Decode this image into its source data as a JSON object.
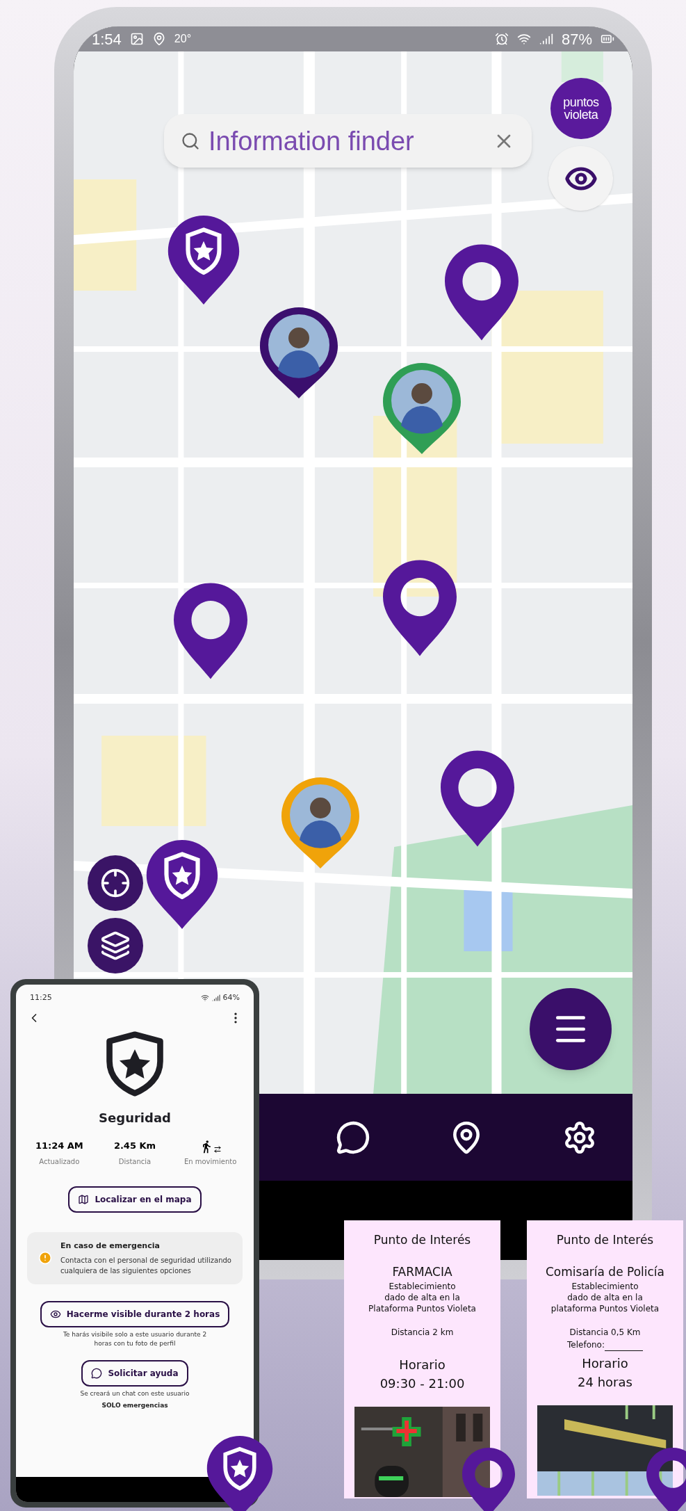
{
  "main_phone": {
    "status_bar": {
      "time": "1:54",
      "temperature": "20°",
      "battery": "87%"
    },
    "logo": [
      "puntos",
      "violeta"
    ],
    "search": {
      "overlay_title": "Information finder"
    },
    "markers": [
      {
        "kind": "police"
      },
      {
        "kind": "pin"
      },
      {
        "kind": "avatar",
        "color": "#3b0f6e"
      },
      {
        "kind": "avatar",
        "color": "#2f9e55"
      },
      {
        "kind": "pin"
      },
      {
        "kind": "pin"
      },
      {
        "kind": "avatar",
        "color": "#f0a30a"
      },
      {
        "kind": "pin"
      },
      {
        "kind": "police"
      }
    ],
    "nav": [
      {
        "kind": "chat"
      },
      {
        "kind": "poi"
      },
      {
        "kind": "settings"
      }
    ]
  },
  "detail_phone": {
    "status_bar": {
      "time": "11:25",
      "battery": "64%"
    },
    "title": "Seguridad",
    "stats": [
      {
        "kind": "text",
        "value": "11:24 AM",
        "label": "Actualizado"
      },
      {
        "kind": "text",
        "value": "2.45 Km",
        "label": "Distancia"
      },
      {
        "kind": "icon",
        "label": "En movimiento"
      }
    ],
    "locate_button": "Localizar en el mapa",
    "emergency": {
      "title": "En caso de emergencia",
      "text": "Contacta con el personal de seguridad utilizando cualquiera de las siguientes opciones"
    },
    "actions": [
      {
        "kind": "visible",
        "label": "Hacerme visible durante 2 horas",
        "note": "Te harás visibile solo a este usuario durante 2 horas con tu foto de perfil"
      },
      {
        "kind": "help",
        "label": "Solicitar ayuda",
        "note": "Se creará un chat con este usuario",
        "note_strong": "SOLO emergencias"
      }
    ]
  },
  "cards": [
    {
      "header": "Punto de Interés",
      "name": "FARMACIA",
      "description": "Establecimiento\ndado de alta en la\nPlataforma Puntos Violeta",
      "distance": "Distancia 2 km",
      "hours_title": "Horario",
      "hours": "09:30 - 21:00"
    },
    {
      "header": "Punto de Interés",
      "name": "Comisaría de Policía",
      "description": "Establecimiento\ndado de alta en la\nplataforma Puntos Violeta",
      "distance": "Distancia 0,5 Km",
      "phone": "Telefono:",
      "hours_title": "Horario",
      "hours": "24 horas"
    }
  ],
  "page_markers": [
    {
      "kind": "police"
    },
    {
      "kind": "pin"
    },
    {
      "kind": "pin"
    }
  ]
}
